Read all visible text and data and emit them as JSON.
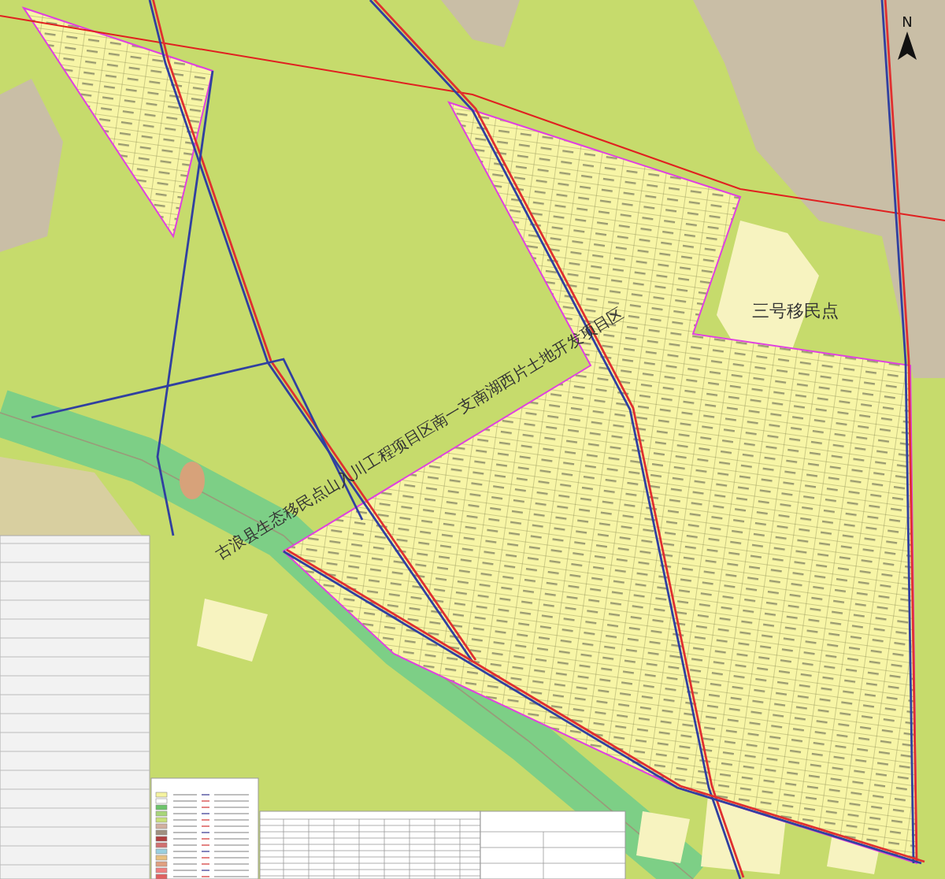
{
  "map": {
    "north_label": "N",
    "labels": [
      {
        "kind": "project",
        "text": "古浪县生态移民点山入川工程项目区南一支南湖西片土地开发项目区"
      },
      {
        "kind": "settlement",
        "text": "三号移民点"
      }
    ]
  }
}
